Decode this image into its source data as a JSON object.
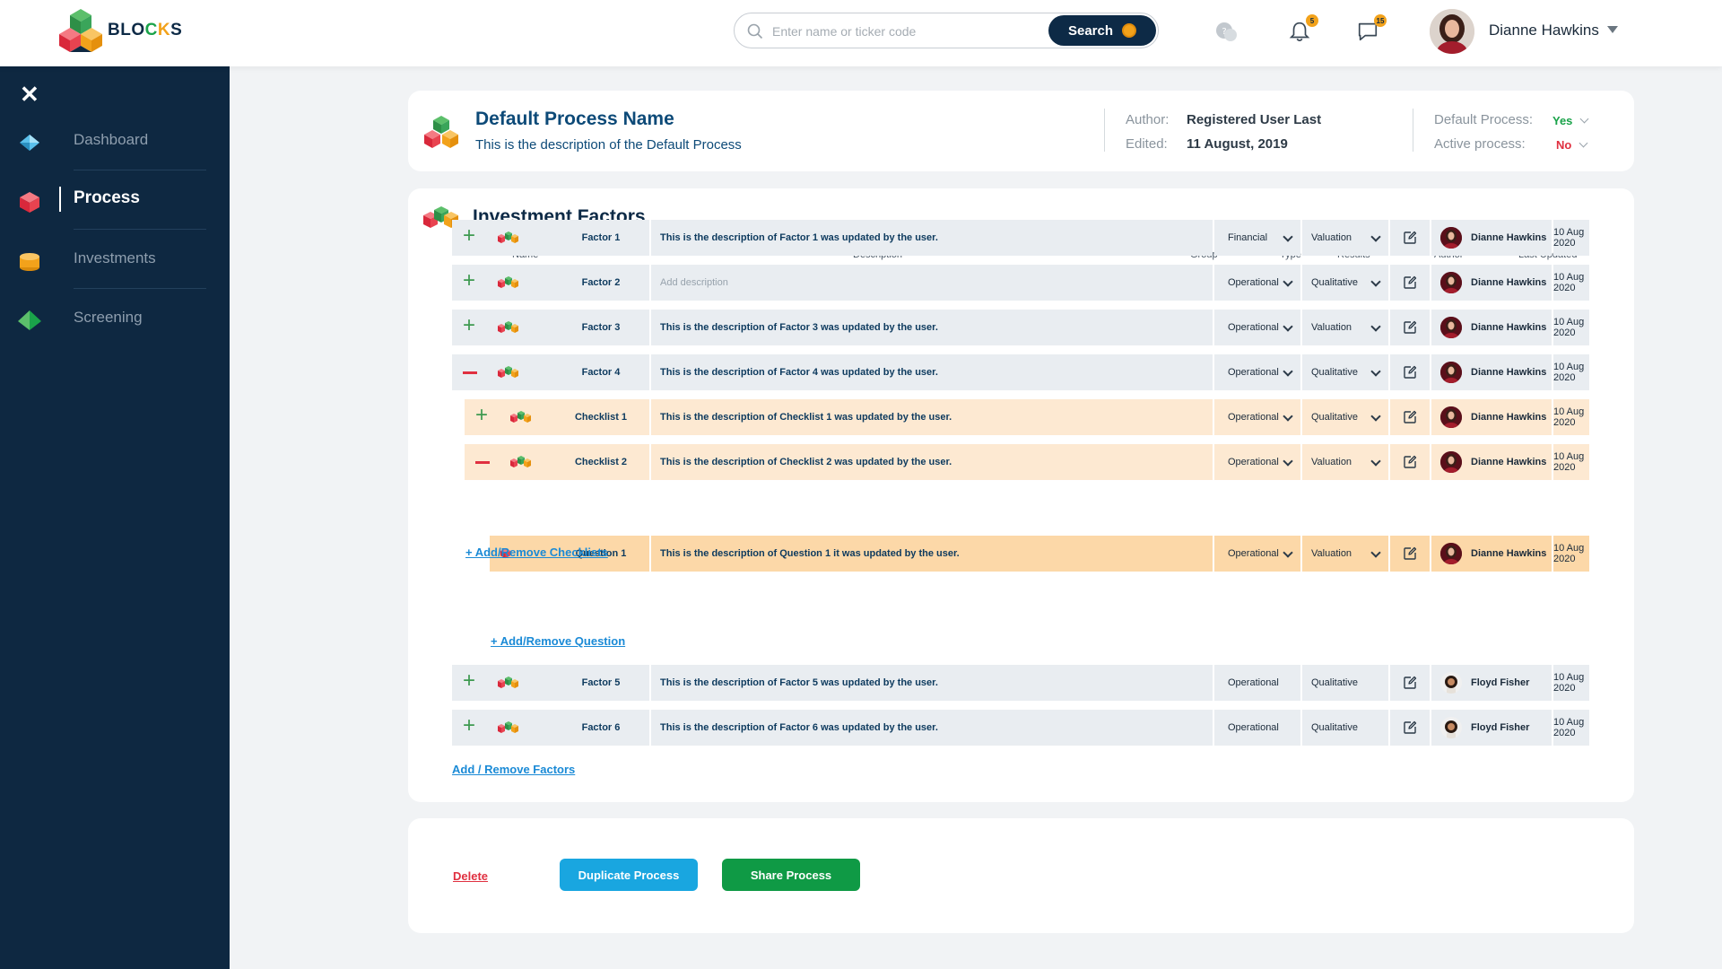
{
  "app": {
    "logo_text_a": "BLO",
    "logo_text_c": "C",
    "logo_text_k": "K",
    "logo_text_s": "S"
  },
  "search": {
    "placeholder": "Enter name or ticker code",
    "button_label": "Search"
  },
  "notifications": {
    "bell_count": "5",
    "messages_count": "15"
  },
  "user": {
    "name": "Dianne Hawkins"
  },
  "sidebar": {
    "items": [
      {
        "label": "Dashboard",
        "icon": "diamond-icon"
      },
      {
        "label": "Process",
        "icon": "cube-icon",
        "active": true
      },
      {
        "label": "Investments",
        "icon": "coins-icon"
      },
      {
        "label": "Screening",
        "icon": "pyramid-icon"
      }
    ]
  },
  "process": {
    "name": "Default Process Name",
    "description": "This is the description of the Default Process",
    "author_label": "Author:",
    "author_value": "Registered User Last",
    "edited_label": "Edited:",
    "edited_value": "11 August, 2019",
    "default_label": "Default Process:",
    "default_value": "Yes",
    "active_label": "Active process:",
    "active_value": "No"
  },
  "factors_section": {
    "title": "Investment Factors",
    "columns": [
      "Name",
      "Description",
      "Group",
      "Type",
      "Results",
      "Author",
      "Last Updated"
    ],
    "rows": [
      {
        "kind": "factor",
        "expand": "plus",
        "name": "Factor 1",
        "description": "This is the description of Factor 1 was updated by the user.",
        "group": "Financial",
        "type": "Valuation",
        "author": "Dianne Hawkins",
        "updated": "10 Aug 2020"
      },
      {
        "kind": "factor",
        "expand": "plus",
        "name": "Factor 2",
        "description": "Add description",
        "group": "Operational",
        "type": "Qualitative",
        "author": "Dianne Hawkins",
        "updated": "10 Aug 2020"
      },
      {
        "kind": "factor",
        "expand": "plus",
        "name": "Factor 3",
        "description": "This is the description of Factor 3 was updated by the user.",
        "group": "Operational",
        "type": "Valuation",
        "author": "Dianne Hawkins",
        "updated": "10 Aug 2020"
      },
      {
        "kind": "factor",
        "expand": "minus",
        "name": "Factor 4",
        "description": "This is the description of Factor 4 was updated by the user.",
        "group": "Operational",
        "type": "Qualitative",
        "author": "Dianne Hawkins",
        "updated": "10 Aug 2020"
      },
      {
        "kind": "check",
        "expand": "plus",
        "name": "Checklist 1",
        "description": "This is the description of Checklist 1 was updated by the user.",
        "group": "Operational",
        "type": "Qualitative",
        "author": "Dianne Hawkins",
        "updated": "10 Aug 2020"
      },
      {
        "kind": "check",
        "expand": "minus",
        "name": "Checklist 2",
        "description": "This is the description of Checklist 2 was updated by the user.",
        "group": "Operational",
        "type": "Valuation",
        "author": "Dianne Hawkins",
        "updated": "10 Aug 2020"
      },
      {
        "kind": "question",
        "name": "Question 1",
        "description": "This is the description of Question 1 it was updated by the user.",
        "group": "Operational",
        "type": "Valuation",
        "author": "Dianne Hawkins",
        "updated": "10 Aug 2020"
      },
      {
        "kind": "factor",
        "expand": "plus",
        "name": "Factor 5",
        "description": "This is the description of Factor 5 was updated by the user.",
        "group": "Operational",
        "type": "Qualitative",
        "author": "Floyd Fisher",
        "updated": "10 Aug 2020"
      },
      {
        "kind": "factor",
        "expand": "plus",
        "name": "Factor 6",
        "description": "This is the description of Factor 6 was updated by the user.",
        "group": "Operational",
        "type": "Qualitative",
        "author": "Floyd Fisher",
        "updated": "10 Aug 2020"
      }
    ],
    "add_checklists_label": "+ Add/Remove Checklists",
    "add_question_label": "+ Add/Remove Question",
    "add_factors_label": "Add / Remove Factors"
  },
  "actions": {
    "delete_label": "Delete",
    "duplicate_label": "Duplicate Process",
    "share_label": "Share Process"
  }
}
